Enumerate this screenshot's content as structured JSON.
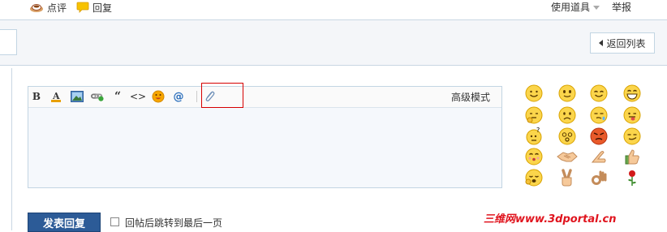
{
  "topbar": {
    "comment_label": "点评",
    "reply_label": "回复",
    "tools_label": "使用道具",
    "report_label": "举报"
  },
  "nav": {
    "back_label": "返回列表"
  },
  "editor": {
    "advanced_mode_label": "高级模式",
    "toolbar_icons": [
      "bold-icon",
      "font-color-icon",
      "image-icon",
      "link-icon",
      "quote-icon",
      "code-icon",
      "emoticon-icon",
      "mention-icon",
      "attachment-icon"
    ],
    "bold_glyph": "B",
    "font_color_glyph": "A",
    "quote_glyph": "“",
    "code_glyph": "<>",
    "mention_glyph": "@",
    "content": ""
  },
  "smileys": {
    "names": [
      "smile-icon",
      "smile2-icon",
      "smile3-icon",
      "grin-icon",
      "think-icon",
      "sad-icon",
      "blush-icon",
      "tongue-icon",
      "confused-icon",
      "dizzy-icon",
      "angry-icon",
      "smirk-icon",
      "kiss-icon",
      "handshake-icon",
      "point-icon",
      "thumbs-up-icon",
      "cry-icon",
      "victory-icon",
      "ok-icon",
      "rose-icon"
    ]
  },
  "bottom": {
    "submit_label": "发表回复",
    "jump_label": "回帖后跳转到最后一页",
    "jump_checked": false
  },
  "watermark": "三维网www.3dportal.cn",
  "colors": {
    "submit_bg": "#2c5b97",
    "border": "#c2d5e3",
    "highlight_box": "#d60000",
    "watermark": "#e0141e"
  }
}
